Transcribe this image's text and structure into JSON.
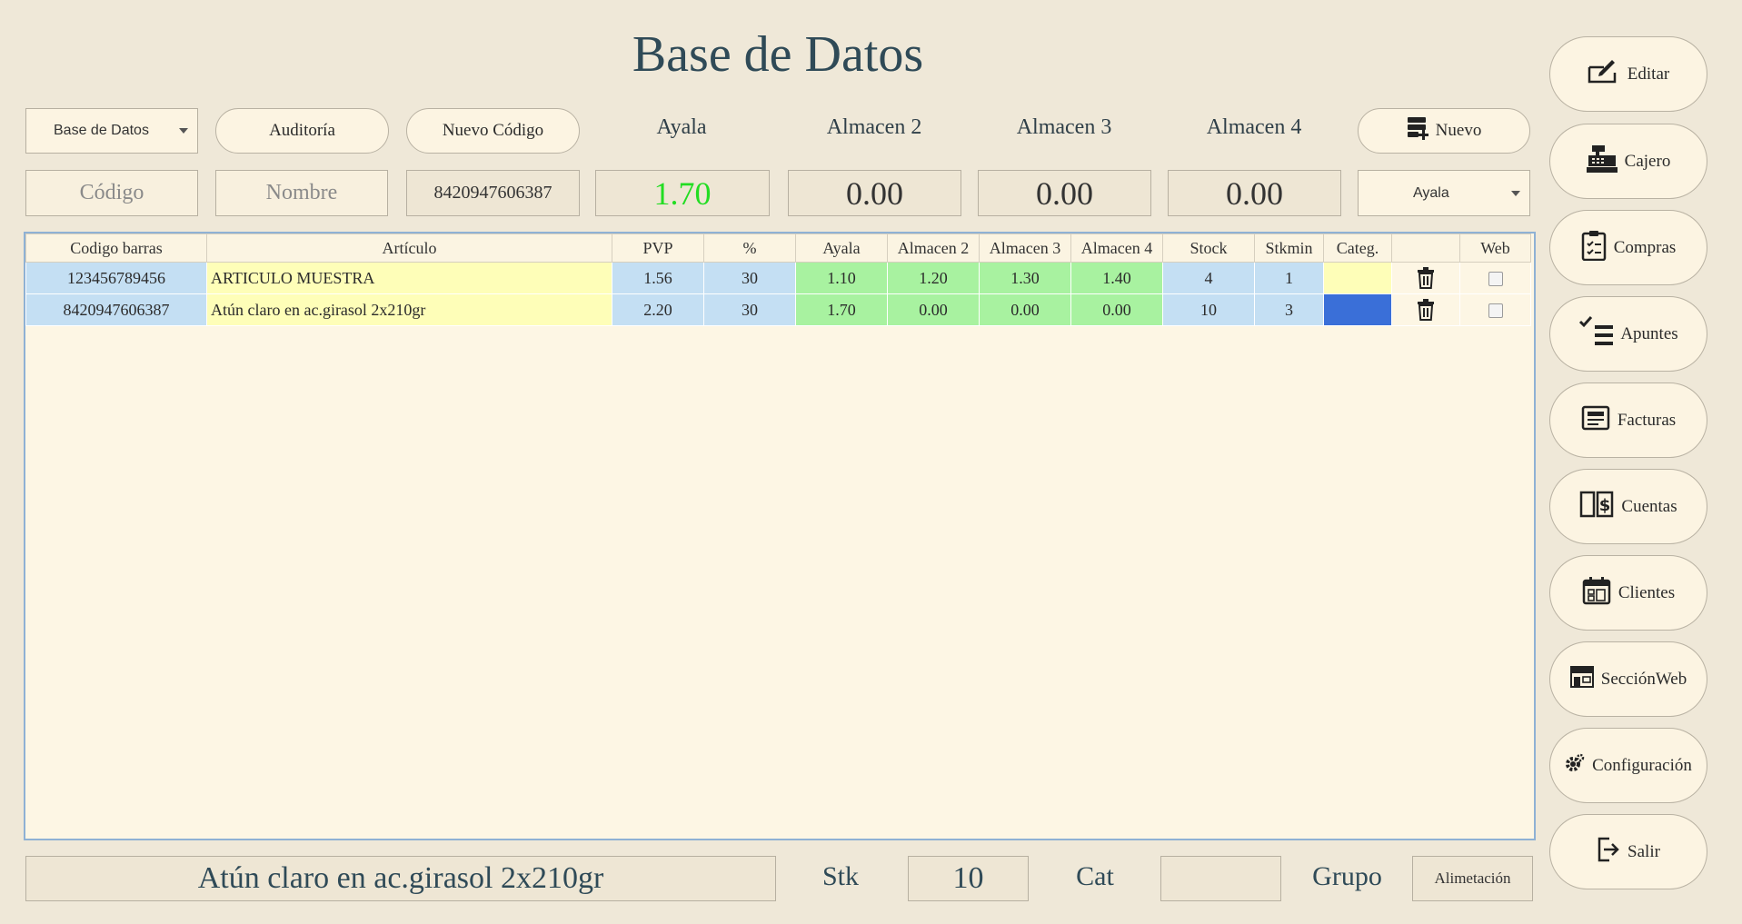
{
  "title": "Base de Datos",
  "toolbar": {
    "db_select": "Base de Datos",
    "auditoria": "Auditoría",
    "nuevo_codigo": "Nuevo Código",
    "nuevo": "Nuevo"
  },
  "warehouses": {
    "labels": [
      "Ayala",
      "Almacen 2",
      "Almacen 3",
      "Almacen 4"
    ],
    "values": [
      "1.70",
      "0.00",
      "0.00",
      "0.00"
    ],
    "active_color": "#22dd22"
  },
  "search": {
    "codigo_placeholder": "Código",
    "nombre_placeholder": "Nombre",
    "barcode_value": "8420947606387",
    "store_select": "Ayala"
  },
  "table": {
    "headers": [
      "Codigo barras",
      "Artículo",
      "PVP",
      "%",
      "Ayala",
      "Almacen 2",
      "Almacen 3",
      "Almacen 4",
      "Stock",
      "Stkmin",
      "Categ.",
      "",
      "Web"
    ],
    "rows": [
      {
        "codigo": "123456789456",
        "articulo": "ARTICULO MUESTRA",
        "pvp": "1.56",
        "pct": "30",
        "ayala": "1.10",
        "alm2": "1.20",
        "alm3": "1.30",
        "alm4": "1.40",
        "stock": "4",
        "stkmin": "1",
        "categ_color": "#fefeb8"
      },
      {
        "codigo": "8420947606387",
        "articulo": "Atún claro en ac.girasol 2x210gr",
        "pvp": "2.20",
        "pct": "30",
        "ayala": "1.70",
        "alm2": "0.00",
        "alm3": "0.00",
        "alm4": "0.00",
        "stock": "10",
        "stkmin": "3",
        "categ_color": "#3a6fd8"
      }
    ]
  },
  "footer": {
    "article_name": "Atún claro en ac.girasol 2x210gr",
    "stk_label": "Stk",
    "stk_value": "10",
    "cat_label": "Cat",
    "cat_value": "",
    "grupo_label": "Grupo",
    "grupo_value": "Alimetación"
  },
  "sidebar": [
    {
      "label": "Editar",
      "icon": "edit-icon"
    },
    {
      "label": "Cajero",
      "icon": "cash-register-icon"
    },
    {
      "label": "Compras",
      "icon": "clipboard-icon"
    },
    {
      "label": "Apuntes",
      "icon": "checklist-icon"
    },
    {
      "label": "Facturas",
      "icon": "invoice-icon"
    },
    {
      "label": "Cuentas",
      "icon": "accounts-book-icon"
    },
    {
      "label": "Clientes",
      "icon": "calendar-icon"
    },
    {
      "label": "SecciónWeb",
      "icon": "storefront-icon"
    },
    {
      "label": "Configuración",
      "icon": "gear-icon"
    },
    {
      "label": "Salir",
      "icon": "exit-icon"
    }
  ]
}
